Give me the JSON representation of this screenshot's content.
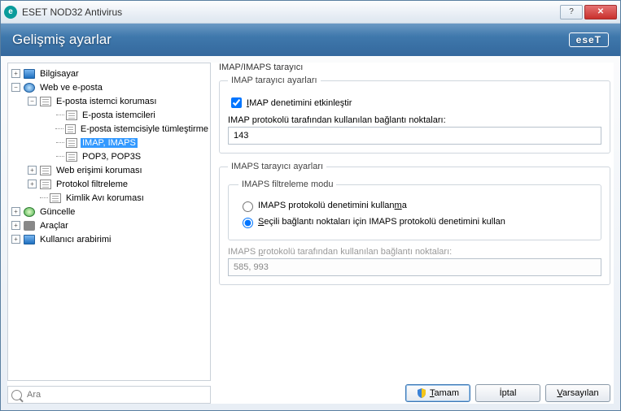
{
  "window": {
    "title": "ESET NOD32 Antivirus"
  },
  "header": {
    "title": "Gelişmiş ayarlar",
    "logo": "eseT"
  },
  "tree": {
    "n_computer": "Bilgisayar",
    "n_web_email": "Web ve e-posta",
    "n_email_protection": "E-posta istemci koruması",
    "n_email_clients": "E-posta istemcileri",
    "n_email_integration": "E-posta istemcisiyle tümleştirme",
    "n_imap": "IMAP, IMAPS",
    "n_pop3": "POP3, POP3S",
    "n_web_access": "Web erişimi koruması",
    "n_protocol": "Protokol filtreleme",
    "n_antiphish": "Kimlik Avı koruması",
    "n_update": "Güncelle",
    "n_tools": "Araçlar",
    "n_ui": "Kullanıcı arabirimi"
  },
  "search": {
    "placeholder": "Ara"
  },
  "settings": {
    "section_title": "IMAP/IMAPS tarayıcı",
    "imap_group": "IMAP tarayıcı ayarları",
    "chk_enable_imap": "IMAP denetimini etkinleştir",
    "imap_ports_label": "IMAP protokolü tarafından kullanılan bağlantı noktaları:",
    "imap_ports_value": "143",
    "imaps_group": "IMAPS tarayıcı ayarları",
    "imaps_filter_group": "IMAPS filtreleme modu",
    "radio_no_imaps": "IMAPS protokolü denetimini kullanma",
    "radio_selected_ports": "Seçili bağlantı noktaları için IMAPS protokolü denetimini kullan",
    "imaps_ports_label": "IMAPS protokolü tarafından kullanılan bağlantı noktaları:",
    "imaps_ports_value": "585, 993"
  },
  "buttons": {
    "ok": "Tamam",
    "cancel": "İptal",
    "defaults": "Varsayılan"
  }
}
